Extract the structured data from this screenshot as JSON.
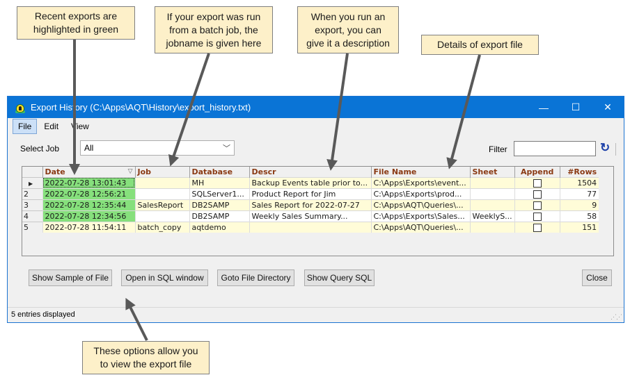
{
  "callouts": {
    "recent": "Recent exports are\nhighlighted in green",
    "job": "If your export was run\nfrom a batch job, the\njobname is given here",
    "descr": "When you run an\nexport, you can\ngive it a description",
    "details": "Details of export file",
    "options": "These options allow you\nto view the export file"
  },
  "window": {
    "title": "Export History (C:\\Apps\\AQT\\History\\export_history.txt)",
    "controls": {
      "minimize": "—",
      "maximize": "☐",
      "close": "✕"
    }
  },
  "menu": {
    "items": [
      "File",
      "Edit",
      "View"
    ],
    "active": "File"
  },
  "filters": {
    "select_job_label": "Select Job",
    "select_job_value": "All",
    "filter_label": "Filter",
    "filter_value": ""
  },
  "grid": {
    "columns": [
      "Date",
      "Job",
      "Database",
      "Descr",
      "File Name",
      "Sheet",
      "Append",
      "#Rows"
    ],
    "rows": [
      {
        "rownum": "",
        "date": "2022-07-28 13:01:43",
        "job": "",
        "database": "MH",
        "descr": "Backup Events table prior to...",
        "file": "C:\\Apps\\Exports\\event...",
        "sheet": "",
        "append": false,
        "rows": "1504",
        "recent": true
      },
      {
        "rownum": "2",
        "date": "2022-07-28 12:56:21",
        "job": "",
        "database": "SQLServer1...",
        "descr": "Product Report for Jim",
        "file": "C:\\Apps\\Exports\\prod...",
        "sheet": "",
        "append": false,
        "rows": "77",
        "recent": true
      },
      {
        "rownum": "3",
        "date": "2022-07-28 12:35:44",
        "job": "SalesReport",
        "database": "DB2SAMP",
        "descr": "Sales Report for 2022-07-27",
        "file": "C:\\Apps\\AQT\\Queries\\...",
        "sheet": "",
        "append": false,
        "rows": "9",
        "recent": true
      },
      {
        "rownum": "4",
        "date": "2022-07-28 12:34:56",
        "job": "",
        "database": "DB2SAMP",
        "descr": "Weekly Sales Summary...",
        "file": "C:\\Apps\\Exports\\Sales...",
        "sheet": "WeeklyS...",
        "append": false,
        "rows": "58",
        "recent": true
      },
      {
        "rownum": "5",
        "date": "2022-07-28 11:54:11",
        "job": "batch_copy",
        "database": "aqtdemo",
        "descr": "",
        "file": "C:\\Apps\\AQT\\Queries\\...",
        "sheet": "",
        "append": false,
        "rows": "151",
        "recent": false
      }
    ]
  },
  "buttons": {
    "show_sample": "Show Sample of File",
    "open_sql": "Open in SQL window",
    "goto_dir": "Goto File Directory",
    "show_query": "Show Query SQL",
    "close": "Close"
  },
  "status": "5 entries displayed",
  "colors": {
    "titlebar": "#0a74d6",
    "recent_highlight": "#86e07c",
    "row_alt": "#fffcd8",
    "header_text": "#8a3a14",
    "callout_bg": "#fdf0c9"
  }
}
